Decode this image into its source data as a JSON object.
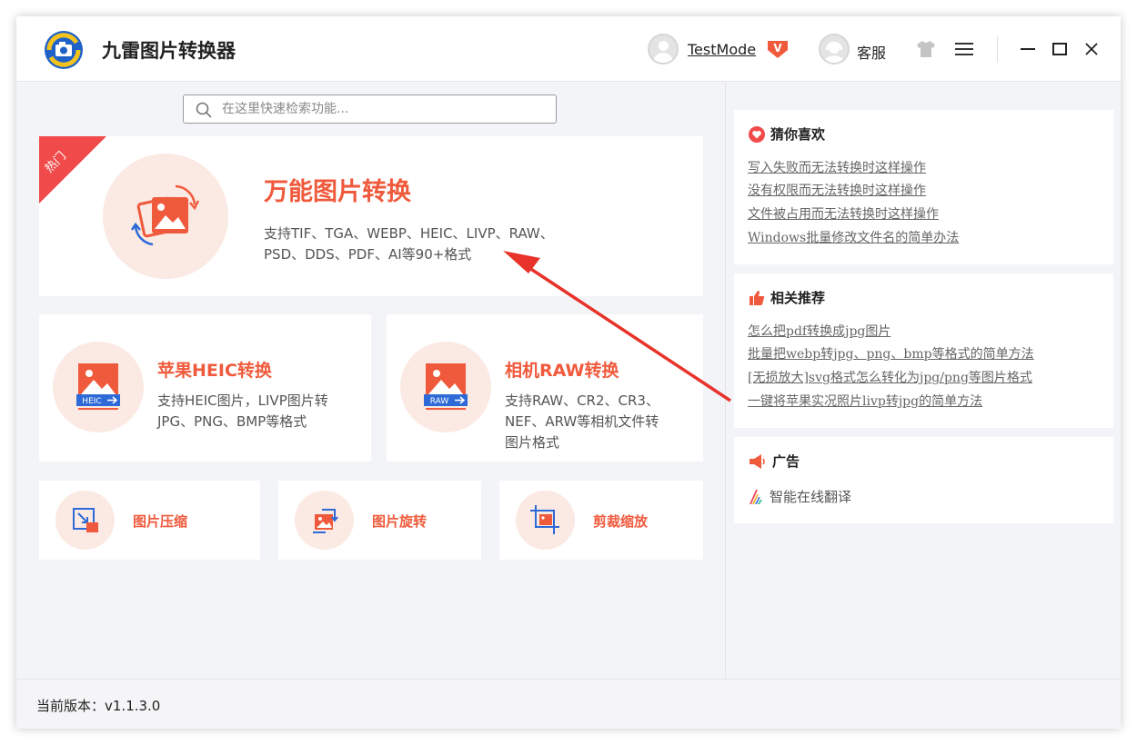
{
  "app": {
    "title": "九雷图片转换器",
    "user_name": "TestMode",
    "vip_badge": "V",
    "support_label": "客服"
  },
  "search": {
    "placeholder": "在这里快速检索功能..."
  },
  "featured": {
    "badge": "热门",
    "title": "万能图片转换",
    "desc_line1": "支持TIF、TGA、WEBP、HEIC、LIVP、RAW、",
    "desc_line2": "PSD、DDS、PDF、AI等90+格式"
  },
  "heic_card": {
    "title": "苹果HEIC转换",
    "icon_label": "HEIC",
    "desc_line1": "支持HEIC图片，LIVP图片转",
    "desc_line2": "JPG、PNG、BMP等格式"
  },
  "raw_card": {
    "title": "相机RAW转换",
    "icon_label": "RAW",
    "desc_line1": "支持RAW、CR2、CR3、",
    "desc_line2": "NEF、ARW等相机文件转",
    "desc_line3": "图片格式"
  },
  "tools": [
    "图片压缩",
    "图片旋转",
    "剪裁缩放"
  ],
  "recommend": {
    "title": "猜你喜欢",
    "links": [
      "写入失败而无法转换时这样操作",
      "没有权限而无法转换时这样操作",
      "文件被占用而无法转换时这样操作",
      "Windows批量修改文件名的简单办法"
    ]
  },
  "related": {
    "title": "相关推荐",
    "links": [
      "怎么把pdf转换成jpg图片",
      "批量把webp转jpg、png、bmp等格式的简单方法",
      "[无损放大]svg格式怎么转化为jpg/png等图片格式",
      "一键将苹果实况照片livp转jpg的简单方法"
    ]
  },
  "ads": {
    "title": "广告",
    "item": "智能在线翻译"
  },
  "status": {
    "version": "当前版本：v1.1.3.0"
  },
  "colors": {
    "accent": "#f05a3c",
    "ribbon": "#f14a4a",
    "circle_bg": "#fbe9e3",
    "arrow": "#e8332a"
  }
}
